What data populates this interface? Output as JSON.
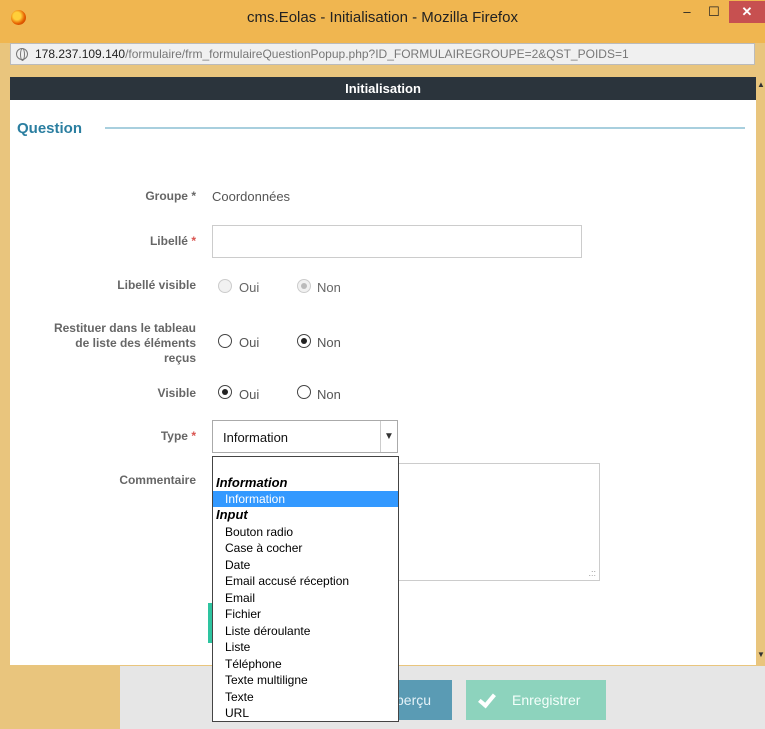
{
  "window": {
    "title": "cms.Eolas - Initialisation - Mozilla Firefox",
    "minimize": "–",
    "maximize": "☐",
    "close": "✕"
  },
  "urlbar": {
    "host": "178.237.109.140",
    "path": "/formulaire/frm_formulaireQuestionPopup.php?ID_FORMULAIREGROUPE=2&QST_POIDS=1"
  },
  "dialog": {
    "header": "Initialisation",
    "section_title": "Question"
  },
  "form": {
    "groupe": {
      "label": "Groupe",
      "required_mark": "*",
      "value": "Coordonnées"
    },
    "libelle": {
      "label": "Libellé",
      "required_mark": "*",
      "value": ""
    },
    "libelle_visible": {
      "label": "Libellé visible",
      "oui": "Oui",
      "non": "Non",
      "selected": "Non",
      "disabled": true
    },
    "restituer": {
      "label_line1": "Restituer dans le tableau",
      "label_line2": "de liste des éléments",
      "label_line3": "reçus",
      "oui": "Oui",
      "non": "Non",
      "selected": "Non"
    },
    "visible": {
      "label": "Visible",
      "oui": "Oui",
      "non": "Non",
      "selected": "Oui"
    },
    "type": {
      "label": "Type",
      "required_mark": "*",
      "value": "Information"
    },
    "commentaire": {
      "label": "Commentaire",
      "resize_grip": ".::"
    }
  },
  "dropdown": {
    "groups": [
      {
        "label": "Information",
        "options": [
          "Information"
        ]
      },
      {
        "label": "Input",
        "options": [
          "Bouton radio",
          "Case à cocher",
          "Date",
          "Email accusé réception",
          "Email",
          "Fichier",
          "Liste déroulante",
          "Liste",
          "Téléphone",
          "Texte multiligne",
          "Texte",
          "URL"
        ]
      }
    ],
    "selected": "Information"
  },
  "footer": {
    "apercu": "perçu",
    "enregistrer": "Enregistrer"
  },
  "colors": {
    "accent": "#2a7ea0",
    "header_bg": "#2b343c",
    "required": "#d9534f",
    "selected_option": "#3399ff"
  }
}
